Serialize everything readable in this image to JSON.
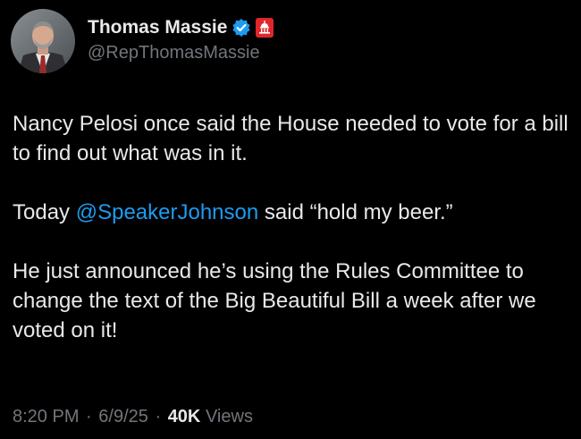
{
  "author": {
    "display_name": "Thomas Massie",
    "handle": "@RepThomasMassie",
    "verified_badge_color": "#1d9bf0",
    "affiliation_badge_color": "#e0262b"
  },
  "tweet": {
    "paragraph_1": "Nancy Pelosi once said the House needed to vote for a bill to find out what was in it.",
    "paragraph_2_before": "Today ",
    "paragraph_2_mention": "@SpeakerJohnson",
    "paragraph_2_after": " said “hold my beer.”",
    "paragraph_3": "He just announced he’s using the Rules Committee to change the text of the Big Beautiful Bill a week after we voted on it!"
  },
  "meta": {
    "time": "8:20 PM",
    "separator": "·",
    "date": "6/9/25",
    "views_count": "40K",
    "views_label": "Views"
  },
  "colors": {
    "background": "#000000",
    "text": "#e7e9ea",
    "secondary_text": "#71767b",
    "link": "#1d9bf0"
  }
}
